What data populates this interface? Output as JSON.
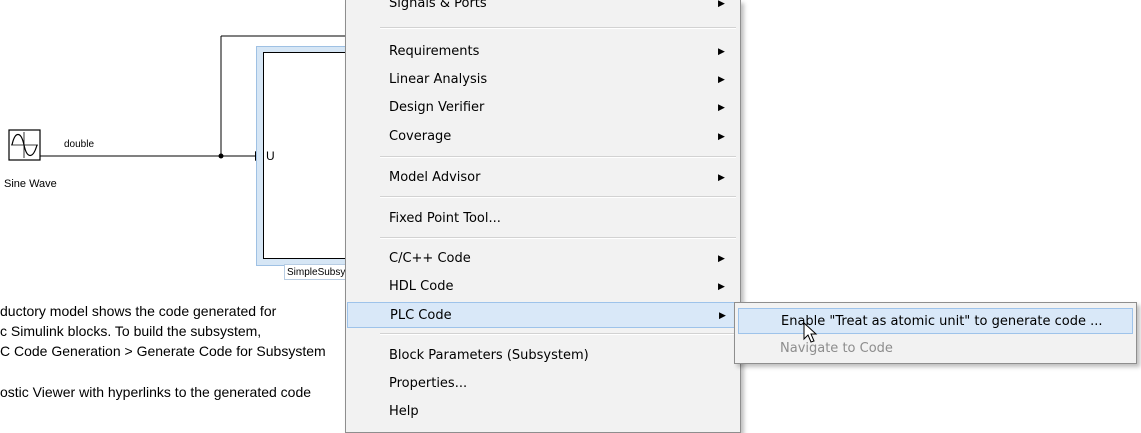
{
  "diagram": {
    "sine_block_name": "Sine Wave",
    "signal_type_label": "double",
    "inport_label": "U",
    "subsystem_name": "SimpleSubsystem",
    "description_lines": [
      "ductory model shows the code generated for",
      "c Simulink blocks.  To build the subsystem,",
      "C Code Generation > Generate Code for Subsystem",
      "",
      "ostic Viewer with hyperlinks to the generated code"
    ]
  },
  "context_menu": {
    "items": [
      {
        "label": "Signals & Ports",
        "submenu": true
      },
      {
        "label": "Requirements",
        "submenu": true
      },
      {
        "label": "Linear Analysis",
        "submenu": true
      },
      {
        "label": "Design Verifier",
        "submenu": true
      },
      {
        "label": "Coverage",
        "submenu": true
      },
      {
        "label": "Model Advisor",
        "submenu": true
      },
      {
        "label": "Fixed Point Tool...",
        "submenu": false
      },
      {
        "label": "C/C++ Code",
        "submenu": true
      },
      {
        "label": "HDL Code",
        "submenu": true
      },
      {
        "label": "PLC Code",
        "submenu": true,
        "highlighted": true
      },
      {
        "label": "Block Parameters (Subsystem)",
        "submenu": false
      },
      {
        "label": "Properties...",
        "submenu": false
      },
      {
        "label": "Help",
        "submenu": false
      }
    ],
    "submenu_arrow_glyph": "▶"
  },
  "plc_submenu": {
    "items": [
      {
        "label": "Enable \"Treat as atomic unit\" to generate code ...",
        "enabled": true,
        "highlighted": true
      },
      {
        "label": "Navigate to Code",
        "enabled": false
      }
    ]
  },
  "colors": {
    "menu_background": "#f2f2f2",
    "highlight": "#d9e8f8",
    "highlight_border": "#9ec3ea",
    "disabled_text": "#8d8d8d",
    "subsystem_selection": "#d6e6f5"
  }
}
